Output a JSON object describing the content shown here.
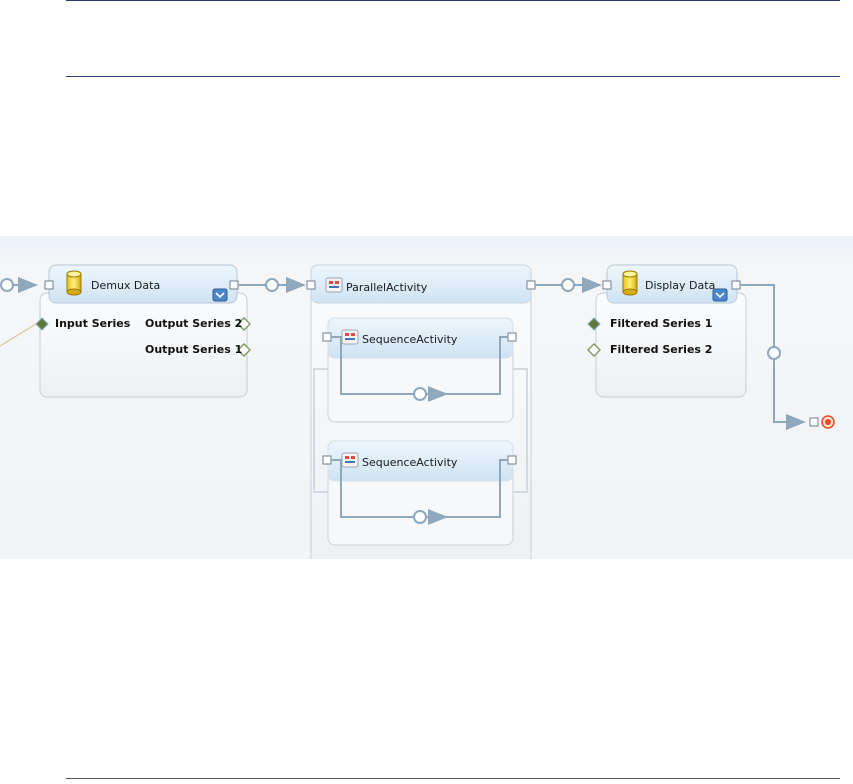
{
  "workflow": {
    "demux": {
      "title": "Demux Data",
      "input_ports": [
        "Input Series"
      ],
      "output_ports": [
        "Output Series 2",
        "Output Series 1"
      ]
    },
    "parallel": {
      "title": "ParallelActivity",
      "branches": [
        {
          "title": "SequenceActivity"
        },
        {
          "title": "SequenceActivity"
        }
      ]
    },
    "display": {
      "title": "Display Data",
      "input_ports": [
        "Filtered Series 1",
        "Filtered Series 2"
      ]
    }
  },
  "colors": {
    "connector": "#8fa8bd",
    "activity_header": "#d9eaf7",
    "activity_border": "#b8c4cf",
    "rule": "#2b3a7a",
    "end_marker": "#e8482b"
  },
  "icons": {
    "data_activity": "database-cylinder-icon",
    "composite_activity": "composite-activity-icon",
    "expand": "chevron-down-icon",
    "port": "port-diamond-icon",
    "end": "workflow-end-icon"
  }
}
